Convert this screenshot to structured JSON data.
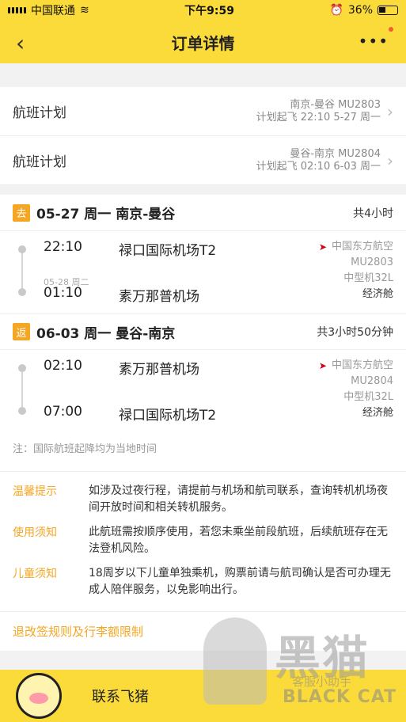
{
  "status_bar": {
    "carrier": "中国联通",
    "time": "下午9:59",
    "battery": "36%"
  },
  "nav": {
    "title": "订单详情",
    "more_label": "•••"
  },
  "plans": [
    {
      "label": "航班计划",
      "route": "南京-曼谷 MU2803",
      "schedule": "计划起飞 22:10 5-27 周一"
    },
    {
      "label": "航班计划",
      "route": "曼谷-南京 MU2804",
      "schedule": "计划起飞 02:10 6-03 周一"
    }
  ],
  "legs": [
    {
      "tag": "去",
      "title": "05-27 周一 南京-曼谷",
      "duration": "共4小时",
      "depart_time": "22:10",
      "depart_airport": "禄口国际机场T2",
      "arrive_date_note": "05-28 周二",
      "arrive_time": "01:10",
      "arrive_airport": "素万那普机场",
      "airline": "中国东方航空",
      "flight_no": "MU2803",
      "aircraft": "中型机32L",
      "cabin": "经济舱"
    },
    {
      "tag": "返",
      "title": "06-03 周一 曼谷-南京",
      "duration": "共3小时50分钟",
      "depart_time": "02:10",
      "depart_airport": "素万那普机场",
      "arrive_date_note": "",
      "arrive_time": "07:00",
      "arrive_airport": "禄口国际机场T2",
      "airline": "中国东方航空",
      "flight_no": "MU2804",
      "aircraft": "中型机32L",
      "cabin": "经济舱"
    }
  ],
  "note": "注：国际航班起降均为当地时间",
  "tips": [
    {
      "key": "温馨提示",
      "value": "如涉及过夜行程，请提前与机场和航司联系，查询转机机场夜间开放时间和相关转机服务。"
    },
    {
      "key": "使用须知",
      "value": "此航班需按顺序使用，若您未乘坐前段航班，后续航班存在无法登机风险。"
    },
    {
      "key": "儿童须知",
      "value": "18周岁以下儿童单独乘机，购票前请与航司确认是否可办理无成人陪伴服务，以免影响出行。"
    }
  ],
  "rules_link": "退改签规则及行李额限制",
  "footer": {
    "contact": "联系飞猪"
  },
  "watermark": {
    "big": "黑猫",
    "sub": "客服小助手",
    "en": "BLACK CAT"
  },
  "colors": {
    "brand_yellow": "#fbdb3a",
    "accent_orange": "#f5a623",
    "airline_red": "#d0021b"
  }
}
